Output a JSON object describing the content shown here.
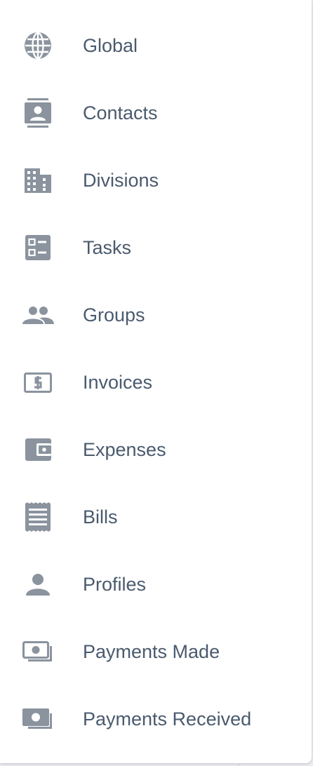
{
  "colors": {
    "icon": "#8a939e",
    "label": "#4a5a6e",
    "background": "#ffffff"
  },
  "menu": {
    "items": [
      {
        "label": "Global",
        "icon": "globe-icon"
      },
      {
        "label": "Contacts",
        "icon": "contact-card-icon"
      },
      {
        "label": "Divisions",
        "icon": "building-icon"
      },
      {
        "label": "Tasks",
        "icon": "checklist-icon"
      },
      {
        "label": "Groups",
        "icon": "people-icon"
      },
      {
        "label": "Invoices",
        "icon": "dollar-bill-icon"
      },
      {
        "label": "Expenses",
        "icon": "wallet-icon"
      },
      {
        "label": "Bills",
        "icon": "receipt-icon"
      },
      {
        "label": "Profiles",
        "icon": "person-icon"
      },
      {
        "label": "Payments Made",
        "icon": "payment-made-icon"
      },
      {
        "label": "Payments Received",
        "icon": "payment-received-icon"
      }
    ]
  }
}
